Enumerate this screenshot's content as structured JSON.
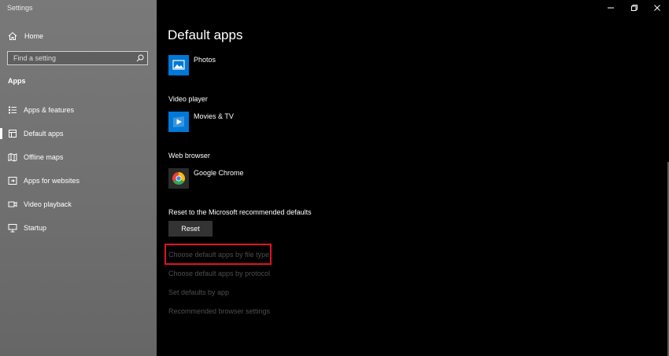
{
  "window": {
    "title": "Settings"
  },
  "sidebar": {
    "home_label": "Home",
    "search": {
      "placeholder": "Find a setting"
    },
    "section_label": "Apps",
    "items": [
      {
        "label": "Apps & features",
        "icon": "list-icon"
      },
      {
        "label": "Default apps",
        "icon": "default-apps-icon",
        "selected": true
      },
      {
        "label": "Offline maps",
        "icon": "map-icon"
      },
      {
        "label": "Apps for websites",
        "icon": "link-app-icon"
      },
      {
        "label": "Video playback",
        "icon": "video-icon"
      },
      {
        "label": "Startup",
        "icon": "startup-icon"
      }
    ]
  },
  "main": {
    "title": "Default apps",
    "photos": {
      "app": "Photos"
    },
    "video_player": {
      "label": "Video player",
      "app": "Movies & TV"
    },
    "web_browser": {
      "label": "Web browser",
      "app": "Google Chrome"
    },
    "reset": {
      "label": "Reset to the Microsoft recommended defaults",
      "button": "Reset"
    },
    "links": [
      "Choose default apps by file type",
      "Choose default apps by protocol",
      "Set defaults by app",
      "Recommended browser settings"
    ]
  },
  "colors": {
    "sidebar_bg": "#707070",
    "main_bg": "#000000",
    "accent_blue": "#0078d7",
    "highlight_red": "#e0121f",
    "link_gray": "#4e4e4e"
  }
}
